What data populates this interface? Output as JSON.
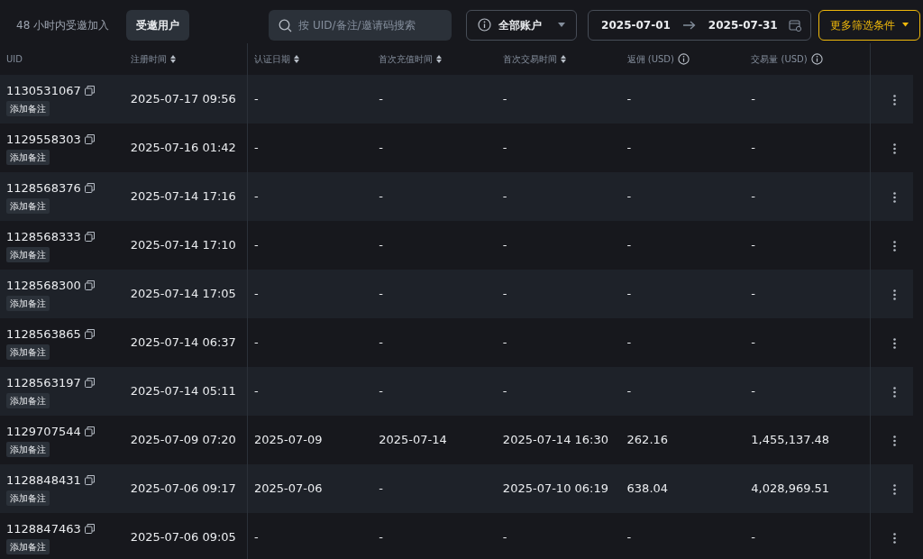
{
  "tabs": [
    {
      "label": "48 小时内受邀加入",
      "selected": false
    },
    {
      "label": "受邀用户",
      "selected": true
    }
  ],
  "search": {
    "placeholder": "按 UID/备注/邀请码搜索"
  },
  "account_filter": {
    "label": "全部账户"
  },
  "date_range": {
    "start": "2025-07-01",
    "end": "2025-07-31"
  },
  "more_filters": {
    "label": "更多筛选条件"
  },
  "table": {
    "columns": [
      {
        "label": "UID",
        "sortable": false,
        "info": false
      },
      {
        "label": "注册时间",
        "sortable": true,
        "info": false
      },
      {
        "label": "认证日期",
        "sortable": true,
        "info": false
      },
      {
        "label": "首次充值时间",
        "sortable": true,
        "info": false
      },
      {
        "label": "首次交易时间",
        "sortable": true,
        "info": false
      },
      {
        "label": "返佣 (USD)",
        "sortable": false,
        "info": true
      },
      {
        "label": "交易量 (USD)",
        "sortable": false,
        "info": true
      }
    ],
    "rows": [
      {
        "note": "添加备注",
        "cells": [
          "1130531067",
          "2025-07-17 09:56",
          "-",
          "-",
          "-",
          "-",
          "-"
        ]
      },
      {
        "note": "添加备注",
        "cells": [
          "1129558303",
          "2025-07-16 01:42",
          "-",
          "-",
          "-",
          "-",
          "-"
        ]
      },
      {
        "note": "添加备注",
        "cells": [
          "1128568376",
          "2025-07-14 17:16",
          "-",
          "-",
          "-",
          "-",
          "-"
        ]
      },
      {
        "note": "添加备注",
        "cells": [
          "1128568333",
          "2025-07-14 17:10",
          "-",
          "-",
          "-",
          "-",
          "-"
        ]
      },
      {
        "note": "添加备注",
        "cells": [
          "1128568300",
          "2025-07-14 17:05",
          "-",
          "-",
          "-",
          "-",
          "-"
        ]
      },
      {
        "note": "添加备注",
        "cells": [
          "1128563865",
          "2025-07-14 06:37",
          "-",
          "-",
          "-",
          "-",
          "-"
        ]
      },
      {
        "note": "添加备注",
        "cells": [
          "1128563197",
          "2025-07-14 05:11",
          "-",
          "-",
          "-",
          "-",
          "-"
        ]
      },
      {
        "note": "添加备注",
        "cells": [
          "1129707544",
          "2025-07-09 07:20",
          "2025-07-09",
          "2025-07-14",
          "2025-07-14 16:30",
          "262.16",
          "1,455,137.48"
        ]
      },
      {
        "note": "添加备注",
        "cells": [
          "1128848431",
          "2025-07-06 09:17",
          "2025-07-06",
          "-",
          "2025-07-10 06:19",
          "638.04",
          "4,028,969.51"
        ]
      },
      {
        "note": "添加备注",
        "cells": [
          "1128847463",
          "2025-07-06 09:05",
          "-",
          "-",
          "-",
          "-",
          "-"
        ]
      }
    ]
  }
}
